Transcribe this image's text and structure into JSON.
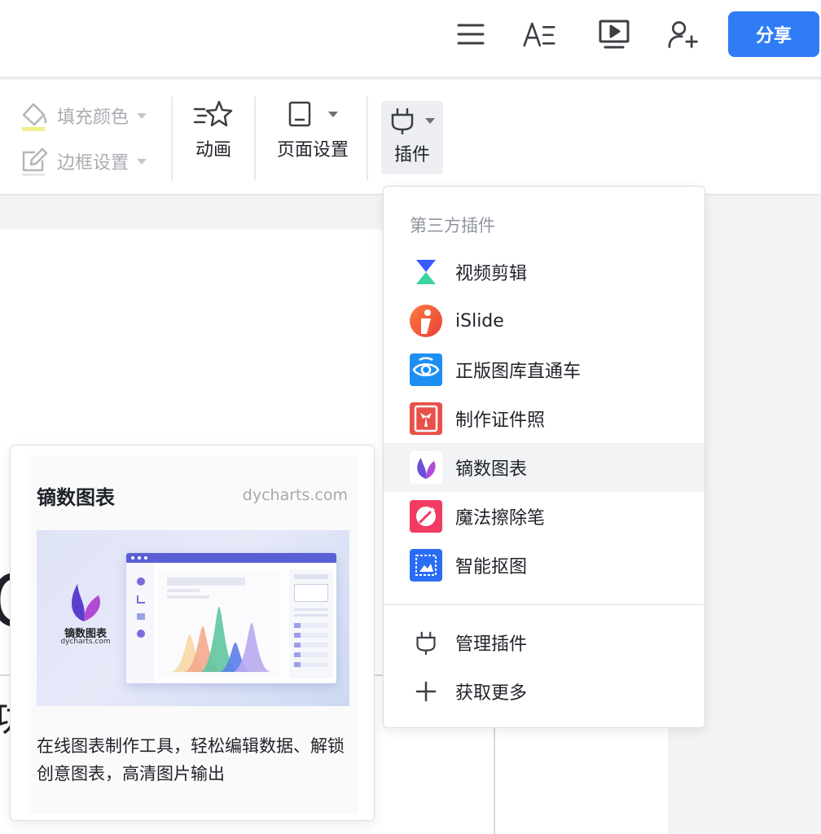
{
  "header": {
    "share_label": "分享",
    "icons": [
      "menu-icon",
      "text-format-icon",
      "present-icon",
      "add-user-icon"
    ]
  },
  "toolbar": {
    "fill_color_label": "填充颜色",
    "border_label": "边框设置",
    "animation_label": "动画",
    "page_setup_label": "页面设置",
    "plugin_label": "插件"
  },
  "slide": {
    "glyph_large": "C",
    "glyph_small": "功"
  },
  "plugin_menu": {
    "section_title": "第三方插件",
    "items": [
      {
        "label": "视频剪辑",
        "icon": "video-edit-icon"
      },
      {
        "label": "iSlide",
        "icon": "islide-icon"
      },
      {
        "label": "正版图库直通车",
        "icon": "stock-gallery-icon"
      },
      {
        "label": "制作证件照",
        "icon": "id-photo-icon"
      },
      {
        "label": "镝数图表",
        "icon": "dycharts-icon"
      },
      {
        "label": "魔法擦除笔",
        "icon": "magic-eraser-icon"
      },
      {
        "label": "智能抠图",
        "icon": "smart-cutout-icon"
      }
    ],
    "manage_label": "管理插件",
    "more_label": "获取更多"
  },
  "preview": {
    "title": "镝数图表",
    "url": "dycharts.com",
    "logo_name": "镝数图表",
    "logo_url": "dycharts.com",
    "description": "在线图表制作工具，轻松编辑数据、解锁创意图表，高清图片输出"
  },
  "colors": {
    "accent": "#2f7cf6",
    "highlight_bg": "#f2f3f5"
  }
}
